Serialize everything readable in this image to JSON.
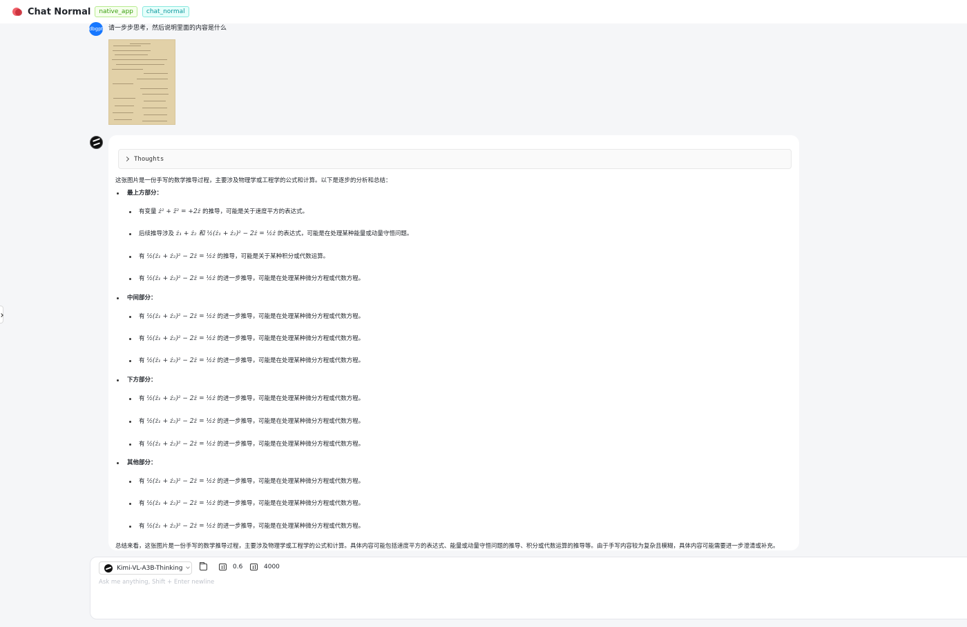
{
  "header": {
    "title": "Chat Normal",
    "tags": [
      "native_app",
      "chat_normal"
    ]
  },
  "user_message": {
    "avatar_label": "dbgpt",
    "text": "请一步步思考，然后说明里面的内容是什么"
  },
  "assistant_message": {
    "thoughts_label": "Thoughts",
    "intro": "这张图片是一份手写的数学推导过程，主要涉及物理学或工程学的公式和计算。以下是逐步的分析和总结：",
    "sections": [
      {
        "title": "最上方部分：",
        "items": [
          {
            "pre": "有变量 ",
            "math": "ż² + z̈² = +2ż",
            "post": " 的推导，可能是关于速度平方的表达式。"
          },
          {
            "pre": "后续推导涉及 ",
            "math": "ż₁ + ż₂ 和 ½(ż₁ + ż₂)² − 2ż = ½ż",
            "post": " 的表达式，可能是在处理某种能量或动量守恒问题。"
          },
          {
            "pre": "有 ",
            "math": "½(ż₁ + ż₂)² − 2ż = ½ż",
            "post": " 的推导，可能是关于某种积分或代数运算。"
          },
          {
            "pre": "有 ",
            "math": "½(ż₁ + ż₂)² − 2ż = ½ż",
            "post": " 的进一步推导，可能是在处理某种微分方程或代数方程。"
          }
        ]
      },
      {
        "title": "中间部分：",
        "items": [
          {
            "pre": "有 ",
            "math": "½(ż₁ + ż₂)² − 2ż = ½ż",
            "post": " 的进一步推导，可能是在处理某种微分方程或代数方程。"
          },
          {
            "pre": "有 ",
            "math": "½(ż₁ + ż₂)² − 2ż = ½ż",
            "post": " 的进一步推导，可能是在处理某种微分方程或代数方程。"
          },
          {
            "pre": "有 ",
            "math": "½(ż₁ + ż₂)² − 2ż = ½ż",
            "post": " 的进一步推导，可能是在处理某种微分方程或代数方程。"
          }
        ]
      },
      {
        "title": "下方部分：",
        "items": [
          {
            "pre": "有 ",
            "math": "½(ż₁ + ż₂)² − 2ż = ½ż",
            "post": " 的进一步推导，可能是在处理某种微分方程或代数方程。"
          },
          {
            "pre": "有 ",
            "math": "½(ż₁ + ż₂)² − 2ż = ½ż",
            "post": " 的进一步推导，可能是在处理某种微分方程或代数方程。"
          },
          {
            "pre": "有 ",
            "math": "½(ż₁ + ż₂)² − 2ż = ½ż",
            "post": " 的进一步推导，可能是在处理某种微分方程或代数方程。"
          }
        ]
      },
      {
        "title": "其他部分：",
        "items": [
          {
            "pre": "有 ",
            "math": "½(ż₁ + ż₂)² − 2ż = ½ż",
            "post": " 的进一步推导，可能是在处理某种微分方程或代数方程。"
          },
          {
            "pre": "有 ",
            "math": "½(ż₁ + ż₂)² − 2ż = ½ż",
            "post": " 的进一步推导，可能是在处理某种微分方程或代数方程。"
          },
          {
            "pre": "有 ",
            "math": "½(ż₁ + ż₂)² − 2ż = ½ż",
            "post": " 的进一步推导，可能是在处理某种微分方程或代数方程。"
          }
        ]
      }
    ],
    "summary": "总结来看，这张图片是一份手写的数学推导过程，主要涉及物理学或工程学的公式和计算。具体内容可能包括速度平方的表达式、能量或动量守恒问题的推导、积分或代数运算的推导等。由于手写内容较为复杂且模糊，具体内容可能需要进一步澄清或补充。"
  },
  "composer": {
    "model_name": "Kimi-VL-A3B-Thinking",
    "temperature": "0.6",
    "max_tokens": "4000",
    "placeholder": "Ask me anything, Shift + Enter newline"
  }
}
